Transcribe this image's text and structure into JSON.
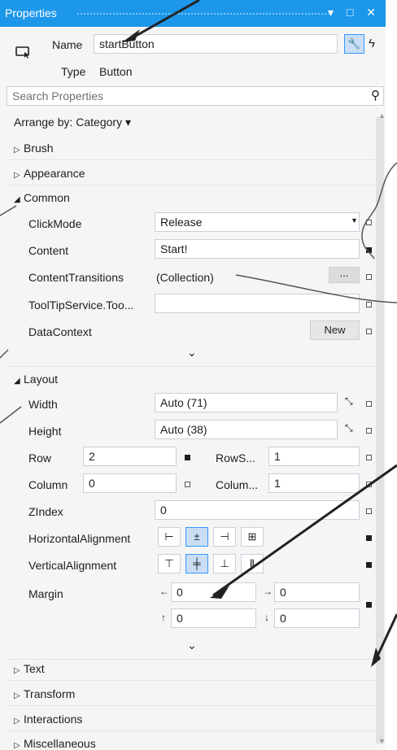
{
  "titlebar": {
    "title": "Properties",
    "icons": "▾ □ ✕"
  },
  "header": {
    "name_label": "Name",
    "name_value": "startButton",
    "type_label": "Type",
    "type_value": "Button",
    "search_placeholder": "Search Properties",
    "arrange_label": "Arrange by: Category ▾"
  },
  "categories": {
    "brush": "Brush",
    "appearance": "Appearance",
    "common": "Common",
    "layout": "Layout",
    "text": "Text",
    "transform": "Transform",
    "interactions": "Interactions",
    "misc": "Miscellaneous"
  },
  "common": {
    "clickmode_label": "ClickMode",
    "clickmode_value": "Release",
    "content_label": "Content",
    "content_value": "Start!",
    "transitions_label": "ContentTransitions",
    "transitions_value": "(Collection)",
    "transitions_button": "...",
    "tooltip_label": "ToolTipService.Too...",
    "tooltip_value": "",
    "datacontext_label": "DataContext",
    "datacontext_button": "New"
  },
  "layout": {
    "width_label": "Width",
    "width_value": "Auto (71)",
    "height_label": "Height",
    "height_value": "Auto (38)",
    "row_label": "Row",
    "row_value": "2",
    "rowspan_label": "RowS...",
    "rowspan_value": "1",
    "column_label": "Column",
    "column_value": "0",
    "colspan_label": "Colum...",
    "colspan_value": "1",
    "zindex_label": "ZIndex",
    "zindex_value": "0",
    "halign_label": "HorizontalAlignment",
    "valign_label": "VerticalAlignment",
    "margin_label": "Margin",
    "margin_left": "0",
    "margin_right": "0",
    "margin_top": "0",
    "margin_bottom": "0"
  },
  "colors": {
    "titlebar": "#1c97ea",
    "panel": "#f5f5f5",
    "selected": "#c9def5"
  }
}
